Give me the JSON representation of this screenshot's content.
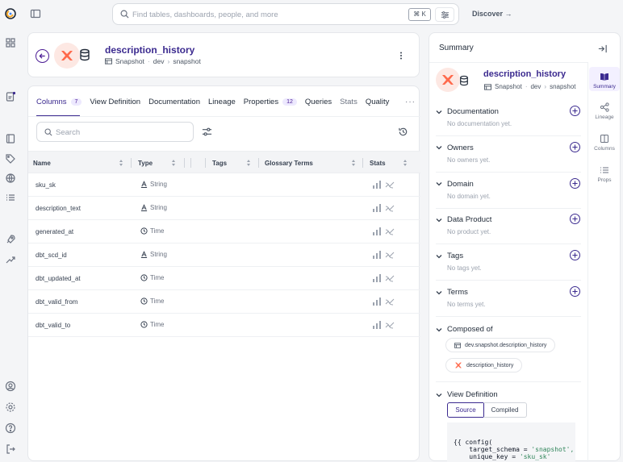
{
  "topbar": {
    "search_placeholder": "Find tables, dashboards, people, and more",
    "shortcut": "⌘ K",
    "discover_label": "Discover →"
  },
  "entity": {
    "title": "description_history",
    "type": "Snapshot",
    "schema": "dev",
    "database": "snapshot"
  },
  "tabs": [
    {
      "label": "Columns",
      "count": "7"
    },
    {
      "label": "View Definition"
    },
    {
      "label": "Documentation"
    },
    {
      "label": "Lineage"
    },
    {
      "label": "Properties",
      "count": "12"
    },
    {
      "label": "Queries"
    },
    {
      "label": "Stats"
    },
    {
      "label": "Quality"
    }
  ],
  "columns_search_placeholder": "Search",
  "table": {
    "headers": [
      "Name",
      "Type",
      "Tags",
      "Glossary Terms",
      "Stats"
    ],
    "rows": [
      {
        "name": "sku_sk",
        "type": "String",
        "type_icon": "string-type-icon"
      },
      {
        "name": "description_text",
        "type": "String",
        "type_icon": "string-type-icon"
      },
      {
        "name": "generated_at",
        "type": "Time",
        "type_icon": "clock-icon"
      },
      {
        "name": "dbt_scd_id",
        "type": "String",
        "type_icon": "string-type-icon"
      },
      {
        "name": "dbt_updated_at",
        "type": "Time",
        "type_icon": "clock-icon"
      },
      {
        "name": "dbt_valid_from",
        "type": "Time",
        "type_icon": "clock-icon"
      },
      {
        "name": "dbt_valid_to",
        "type": "Time",
        "type_icon": "clock-icon"
      }
    ]
  },
  "summary": {
    "title": "Summary",
    "side_tabs": [
      "Summary",
      "Lineage",
      "Columns",
      "Props"
    ],
    "sections": [
      {
        "title": "Documentation",
        "empty": "No documentation yet."
      },
      {
        "title": "Owners",
        "empty": "No owners yet."
      },
      {
        "title": "Domain",
        "empty": "No domain yet."
      },
      {
        "title": "Data Product",
        "empty": "No product yet."
      },
      {
        "title": "Tags",
        "empty": "No tags yet."
      },
      {
        "title": "Terms",
        "empty": "No terms yet."
      }
    ],
    "composed_of": {
      "title": "Composed of",
      "items": [
        "dev.snapshot.description_history",
        "description_history"
      ]
    },
    "view_definition": {
      "title": "View Definition",
      "source_label": "Source",
      "compiled_label": "Compiled",
      "code_line1": "{{ config(",
      "code_line2_key": "    target_schema = ",
      "code_line2_val": "'snapshot',",
      "code_line3_key": "    unique_key = ",
      "code_line3_val": "'sku_sk'"
    }
  },
  "colors": {
    "accent": "#3b2a8f",
    "dbt_orange": "#ff694b"
  }
}
